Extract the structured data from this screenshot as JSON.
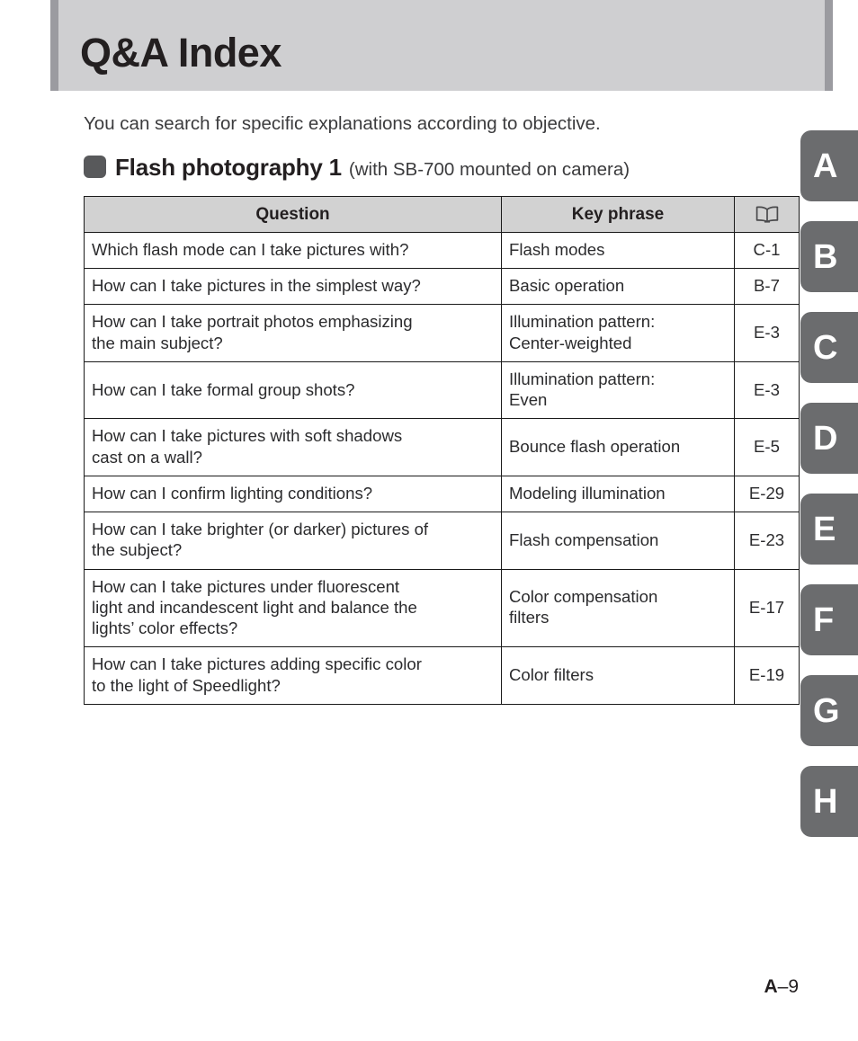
{
  "header": {
    "title": "Q&A Index"
  },
  "intro": {
    "text": "You can search for specific explanations according to objective."
  },
  "section": {
    "bullet_icon": "rounded-square-bullet-icon",
    "title": "Flash photography 1",
    "subtitle": "(with SB-700 mounted on camera)"
  },
  "table": {
    "columns": [
      {
        "label": "Question",
        "icon": null
      },
      {
        "label": "Key phrase",
        "icon": null
      },
      {
        "label": "",
        "icon": "open-book-icon"
      }
    ],
    "rows": [
      {
        "question": [
          "Which flash mode can I take pictures with?"
        ],
        "key_phrase": [
          "Flash modes"
        ],
        "page": "C-1"
      },
      {
        "question": [
          "How can I take pictures in the simplest way?"
        ],
        "key_phrase": [
          "Basic operation"
        ],
        "page": "B-7"
      },
      {
        "question": [
          "How can I take portrait photos emphasizing",
          "the main subject?"
        ],
        "key_phrase": [
          "Illumination pattern:",
          "Center-weighted"
        ],
        "page": "E-3"
      },
      {
        "question": [
          "How can I take formal group shots?"
        ],
        "key_phrase": [
          "Illumination pattern:",
          "Even"
        ],
        "page": "E-3"
      },
      {
        "question": [
          "How can I take pictures with soft shadows",
          "cast on a wall?"
        ],
        "key_phrase": [
          "Bounce flash operation"
        ],
        "page": "E-5"
      },
      {
        "question": [
          "How can I confirm lighting conditions?"
        ],
        "key_phrase": [
          "Modeling illumination"
        ],
        "page": "E-29"
      },
      {
        "question": [
          "How can I take brighter (or darker) pictures of",
          "the subject?"
        ],
        "key_phrase": [
          "Flash compensation"
        ],
        "page": "E-23"
      },
      {
        "question": [
          "How can I take pictures under fluorescent",
          "light and incandescent light and balance the",
          "lights’ color effects?"
        ],
        "key_phrase": [
          "Color compensation",
          "filters"
        ],
        "page": "E-17"
      },
      {
        "question": [
          "How can I take pictures adding specific color",
          "to the light of Speedlight?"
        ],
        "key_phrase": [
          "Color filters"
        ],
        "page": "E-19"
      }
    ]
  },
  "index_tabs": [
    {
      "letter": "A"
    },
    {
      "letter": "B"
    },
    {
      "letter": "C"
    },
    {
      "letter": "D"
    },
    {
      "letter": "E"
    },
    {
      "letter": "F"
    },
    {
      "letter": "G"
    },
    {
      "letter": "H"
    }
  ],
  "footer": {
    "page_letter": "A",
    "page_rest": "–9"
  },
  "colors": {
    "header_band": "#cfcfd1",
    "header_edge": "#9b9ba0",
    "table_header_bg": "#d2d2d2",
    "tab_gray": "#6b6c6e",
    "bullet_gray": "#58595b",
    "text": "#231f20"
  }
}
